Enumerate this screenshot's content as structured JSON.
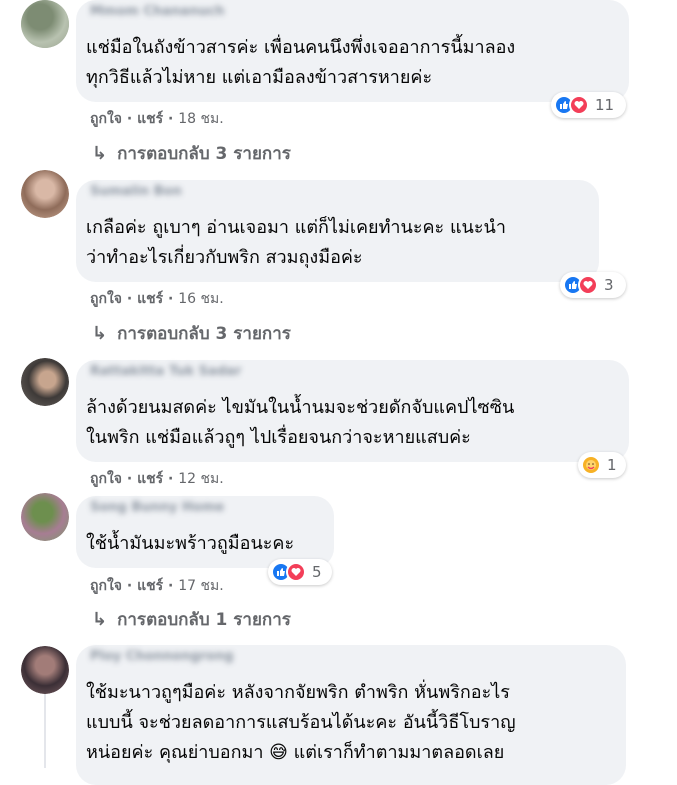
{
  "comments": [
    {
      "author": "Mmom Chananuch",
      "text": "แช่มือในถังข้าวสารค่ะ เพื่อนคนนึงพึ่งเจออาการนี้มาลอง\nทุกวิธีแล้วไม่หาย แต่เอามือลงข้าวสารหายค่ะ",
      "reaction_count": "11",
      "like_label": "ถูกใจ",
      "share_label": "แชร์",
      "time": "18 ชม.",
      "replies": "การตอบกลับ 3 รายการ"
    },
    {
      "author": "Sumalin Bon",
      "text": "เกลือค่ะ ถูเบาๆ อ่านเจอมา แต่ก็ไม่เคยทำนะคะ แนะนำ\nว่าทำอะไรเกี่ยวกับพริก สวมถุงมือค่ะ",
      "reaction_count": "3",
      "like_label": "ถูกใจ",
      "share_label": "แชร์",
      "time": "16 ชม.",
      "replies": "การตอบกลับ 3 รายการ"
    },
    {
      "author": "Rattakitta Tuk Sadar",
      "text": "ล้างด้วยนมสดค่ะ ไขมันในน้ำนมจะช่วยดักจับแคปไซซิน\nในพริก แช่มือแล้วถูๆ ไปเรื่อยจนกว่าจะหายแสบค่ะ",
      "reaction_count": "1",
      "like_label": "ถูกใจ",
      "share_label": "แชร์",
      "time": "12 ชม."
    },
    {
      "author": "Song Bunny Home",
      "text": "ใช้น้ำมันมะพร้าวถูมือนะคะ",
      "reaction_count": "5",
      "like_label": "ถูกใจ",
      "share_label": "แชร์",
      "time": "17 ชม.",
      "replies": "การตอบกลับ 1 รายการ"
    },
    {
      "author": "Ploy Chonnongrong",
      "text": "ใช้มะนาวถูๆมือค่ะ หลังจากจัยพริก ตำพริก หั่นพริกอะไร\nแบบนี้ จะช่วยลดอาการแสบร้อนได้นะคะ อันนี้วิธีโบราญ\nหน่อยค่ะ คุณย่าบอกมา 😅 แต่เราก็ทำตามมาตลอดเลย"
    }
  ],
  "colors": {
    "bubble": "#f0f2f5",
    "meta": "#65676b",
    "like": "#1877f2",
    "love": "#f33e58",
    "care": "#f7b125"
  },
  "icons": [
    "like-icon",
    "love-icon",
    "care-icon",
    "reply-arrow-icon"
  ]
}
